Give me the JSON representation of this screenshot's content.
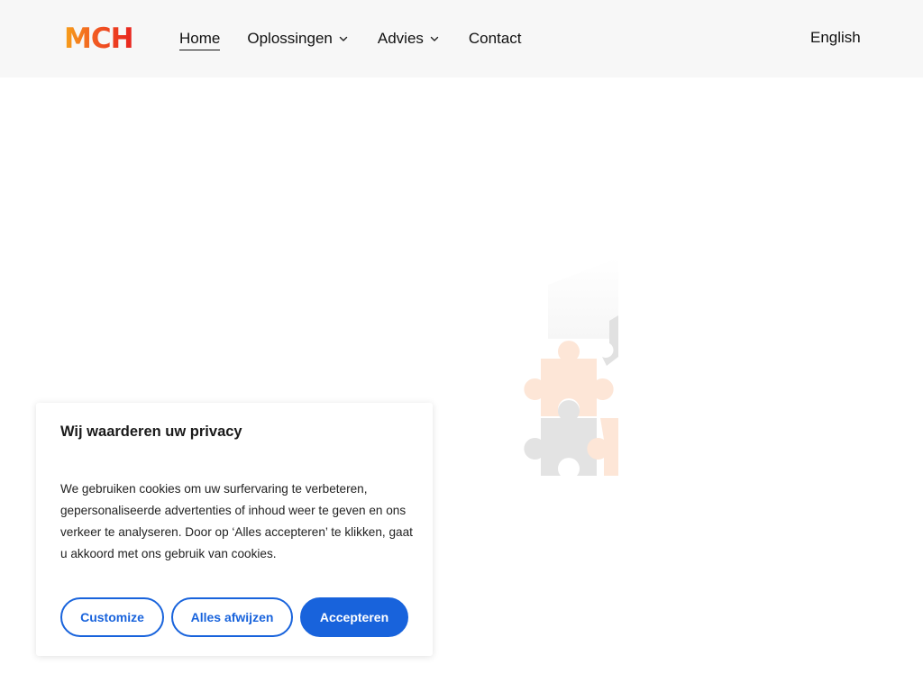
{
  "header": {
    "logo_text": "MCH",
    "nav": [
      {
        "label": "Home"
      },
      {
        "label": "Oplossingen"
      },
      {
        "label": "Advies"
      },
      {
        "label": "Contact"
      }
    ],
    "language": "English"
  },
  "hero": {
    "image_icon": "puzzle-pieces-illustration"
  },
  "cookie_banner": {
    "title": "Wij waarderen uw privacy",
    "text": "We gebruiken cookies om uw surfervaring te verbeteren, gepersonaliseerde advertenties of inhoud weer te geven en ons verkeer te analyseren. Door op ‘Alles accepteren’ te klikken, gaat u akkoord met ons gebruik van cookies.",
    "buttons": {
      "customize": "Customize",
      "reject": "Alles afwijzen",
      "accept": "Accepteren"
    }
  },
  "colors": {
    "accent": "#1863dc",
    "logo_start": "#f7a21b",
    "logo_end": "#e8241f",
    "header_bg": "#f7f7f7"
  }
}
